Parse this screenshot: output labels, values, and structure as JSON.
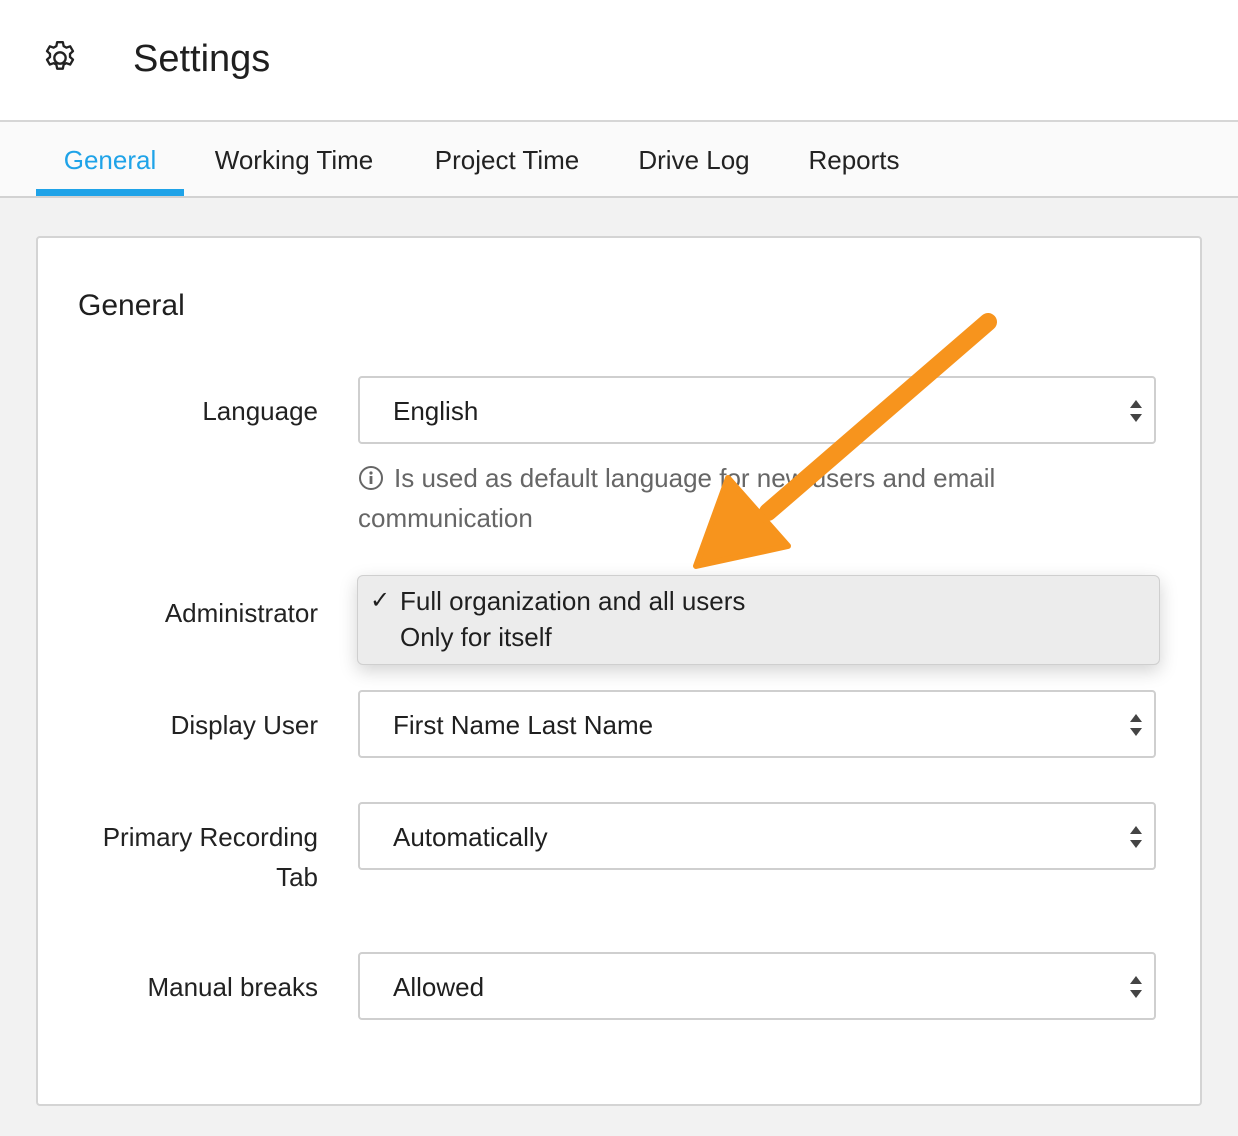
{
  "header": {
    "title": "Settings",
    "icon": "gear-icon"
  },
  "tabs": [
    {
      "label": "General",
      "active": true
    },
    {
      "label": "Working Time",
      "active": false
    },
    {
      "label": "Project Time",
      "active": false
    },
    {
      "label": "Drive Log",
      "active": false
    },
    {
      "label": "Reports",
      "active": false
    }
  ],
  "colors": {
    "accent": "#1fa3e8",
    "annotation_arrow": "#f7941d"
  },
  "section": {
    "title": "General"
  },
  "fields": {
    "language": {
      "label": "Language",
      "value": "English",
      "hint": "Is used as default language for new users and email communication"
    },
    "administrator": {
      "label": "Administrator",
      "options": [
        "Full organization and all users",
        "Only for itself"
      ],
      "selected": "Full organization and all users"
    },
    "display_user": {
      "label": "Display User",
      "value": "First Name Last Name"
    },
    "primary_recording_tab": {
      "label": "Primary Recording Tab",
      "value": "Automatically"
    },
    "manual_breaks": {
      "label": "Manual breaks",
      "value": "Allowed"
    }
  },
  "dropdown": {
    "check_glyph": "✓"
  }
}
